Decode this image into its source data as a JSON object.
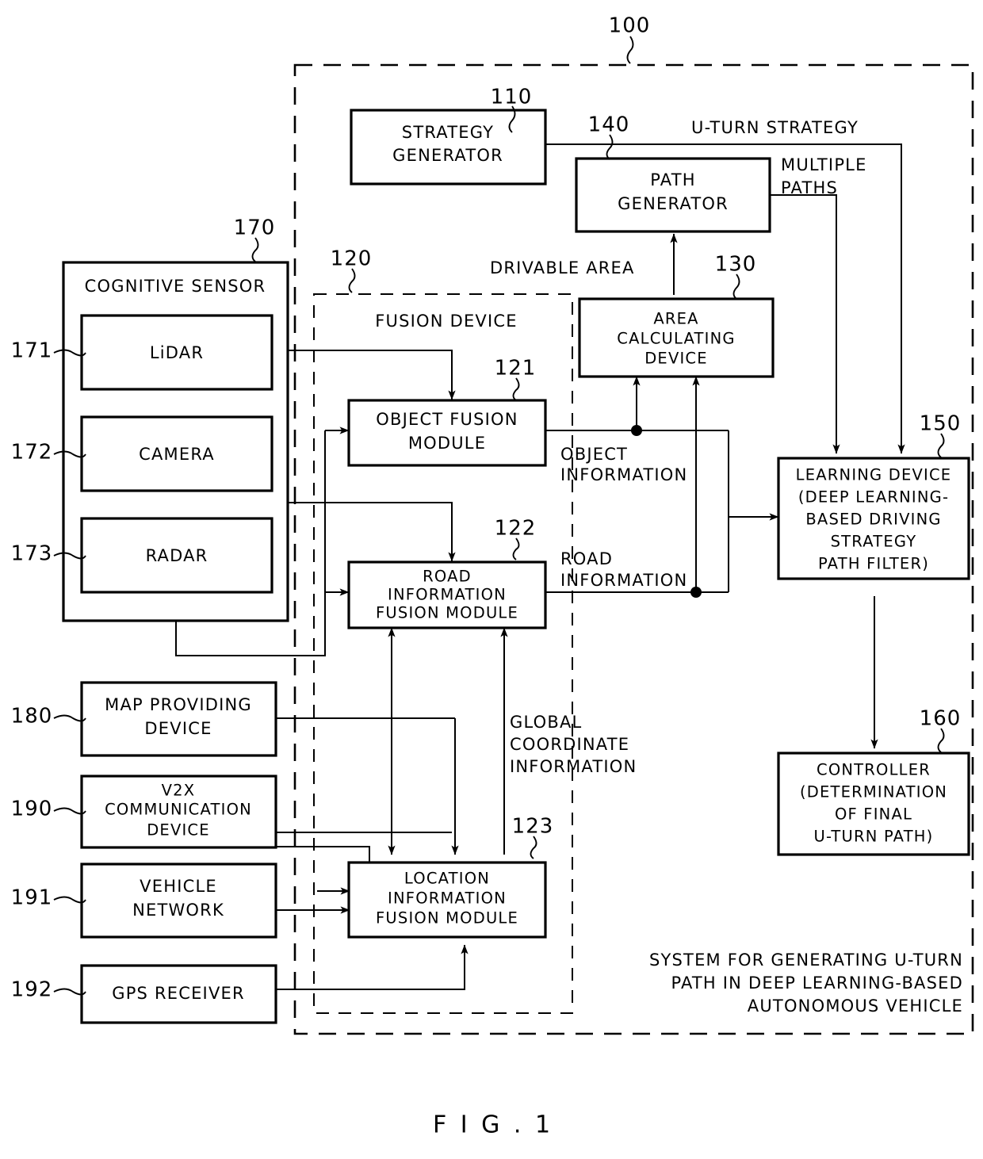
{
  "figure": {
    "caption": "F I G .  1",
    "system_ref": "100",
    "system_title_lines": [
      "SYSTEM FOR GENERATING U-TURN",
      "PATH IN DEEP LEARNING-BASED",
      "AUTONOMOUS VEHICLE"
    ]
  },
  "blocks": {
    "strategy_generator": {
      "ref": "110",
      "lines": [
        "STRATEGY",
        "GENERATOR"
      ]
    },
    "path_generator": {
      "ref": "140",
      "lines": [
        "PATH",
        "GENERATOR"
      ]
    },
    "area_calculating_device": {
      "ref": "130",
      "lines": [
        "AREA",
        "CALCULATING",
        "DEVICE"
      ]
    },
    "learning_device": {
      "ref": "150",
      "lines": [
        "LEARNING DEVICE",
        "(DEEP LEARNING-",
        "BASED DRIVING",
        "STRATEGY",
        "PATH FILTER)"
      ]
    },
    "controller": {
      "ref": "160",
      "lines": [
        "CONTROLLER",
        "(DETERMINATION",
        "OF FINAL",
        "U-TURN PATH)"
      ]
    },
    "cognitive_sensor": {
      "ref": "170",
      "title": "COGNITIVE SENSOR",
      "sensors": [
        {
          "ref": "171",
          "label": "LiDAR"
        },
        {
          "ref": "172",
          "label": "CAMERA"
        },
        {
          "ref": "173",
          "label": "RADAR"
        }
      ]
    },
    "fusion_device": {
      "ref": "120",
      "title": "FUSION DEVICE",
      "modules": [
        {
          "ref": "121",
          "lines": [
            "OBJECT FUSION",
            "MODULE"
          ]
        },
        {
          "ref": "122",
          "lines": [
            "ROAD",
            "INFORMATION",
            "FUSION MODULE"
          ]
        },
        {
          "ref": "123",
          "lines": [
            "LOCATION",
            "INFORMATION",
            "FUSION MODULE"
          ]
        }
      ]
    },
    "map_providing_device": {
      "ref": "180",
      "lines": [
        "MAP PROVIDING",
        "DEVICE"
      ]
    },
    "v2x_communication_device": {
      "ref": "190",
      "lines": [
        "V2X",
        "COMMUNICATION",
        "DEVICE"
      ]
    },
    "vehicle_network": {
      "ref": "191",
      "lines": [
        "VEHICLE",
        "NETWORK"
      ]
    },
    "gps_receiver": {
      "ref": "192",
      "lines": [
        "GPS RECEIVER"
      ]
    }
  },
  "signals": {
    "u_turn_strategy": "U-TURN STRATEGY",
    "multiple_paths": [
      "MULTIPLE",
      "PATHS"
    ],
    "drivable_area": "DRIVABLE AREA",
    "object_information": [
      "OBJECT",
      "INFORMATION"
    ],
    "road_information": [
      "ROAD",
      "INFORMATION"
    ],
    "global_coordinate_information": [
      "GLOBAL",
      "COORDINATE",
      "INFORMATION"
    ]
  }
}
